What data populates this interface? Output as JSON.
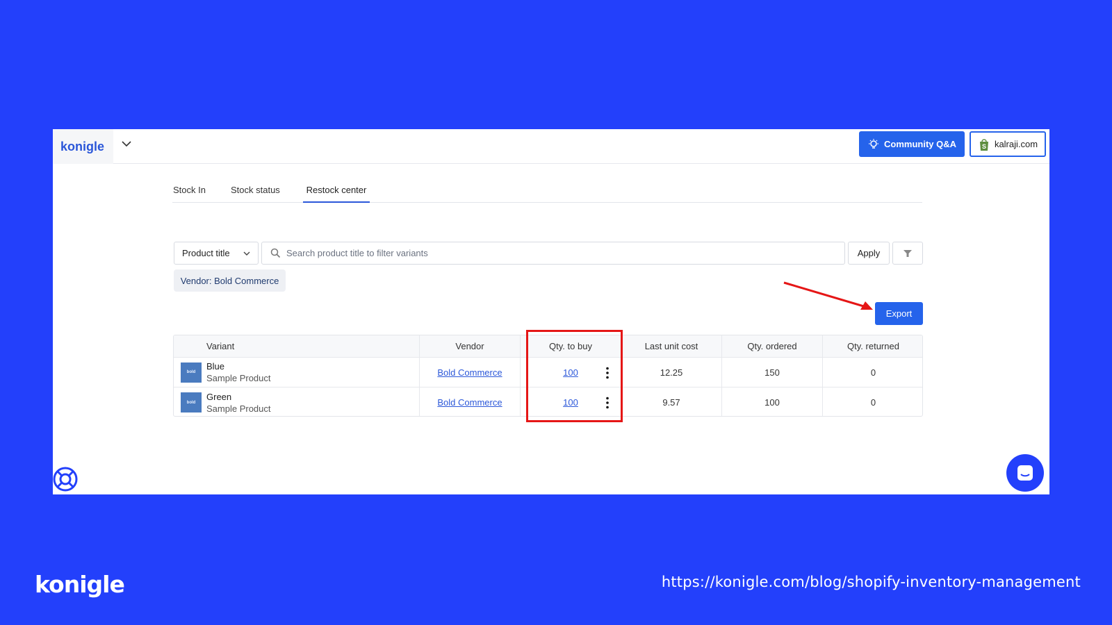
{
  "header": {
    "brand": "konigle",
    "community_label": "Community Q&A",
    "store_label": "kalraji.com"
  },
  "tabs": [
    {
      "label": "Stock In",
      "active": false
    },
    {
      "label": "Stock status",
      "active": false
    },
    {
      "label": "Restock center",
      "active": true
    }
  ],
  "filters": {
    "field_select": "Product title",
    "search_placeholder": "Search product title to filter variants",
    "search_value": "",
    "apply_label": "Apply",
    "active_chip": "Vendor: Bold Commerce"
  },
  "export_label": "Export",
  "table": {
    "columns": [
      "Variant",
      "Vendor",
      "Qty. to buy",
      "Last unit cost",
      "Qty. ordered",
      "Qty. returned"
    ],
    "rows": [
      {
        "thumb_text": "bold",
        "variant": "Blue",
        "product": "Sample Product",
        "vendor": "Bold Commerce",
        "qty_to_buy": "100",
        "last_unit_cost": "12.25",
        "qty_ordered": "150",
        "qty_returned": "0"
      },
      {
        "thumb_text": "bold",
        "variant": "Green",
        "product": "Sample Product",
        "vendor": "Bold Commerce",
        "qty_to_buy": "100",
        "last_unit_cost": "9.57",
        "qty_ordered": "100",
        "qty_returned": "0"
      }
    ]
  },
  "footer": {
    "logo": "konigle",
    "url": "https://konigle.com/blog/shopify-inventory-management"
  },
  "colors": {
    "background": "#2340fb",
    "primary": "#2563eb",
    "annotation": "#e51616"
  },
  "icons": [
    "chevron-down-icon",
    "lightbulb-icon",
    "shopify-bag-icon",
    "search-icon",
    "filter-icon",
    "kebab-menu-icon",
    "lifebuoy-icon",
    "chat-icon"
  ]
}
